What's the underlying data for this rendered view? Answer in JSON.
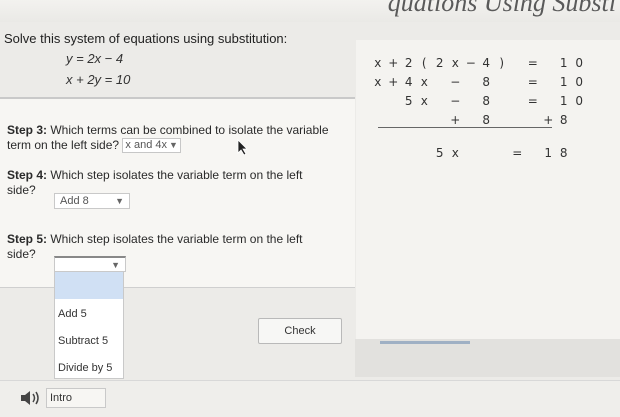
{
  "header": {
    "banner_text": "quations Using Substi"
  },
  "problem": {
    "instruction": "Solve this system of equations using substitution:",
    "equation1": "y = 2x − 4",
    "equation2": "x + 2y = 10"
  },
  "work": {
    "rows": [
      [
        "x",
        "+",
        "2",
        "(",
        "2",
        "x",
        "−",
        "4",
        ")",
        "",
        "=",
        "",
        "1",
        "0"
      ],
      [
        "x",
        "+",
        "4",
        "x",
        "",
        "−",
        "",
        "8",
        "",
        "",
        "=",
        "",
        "1",
        "0"
      ],
      [
        "",
        "",
        "5",
        "x",
        "",
        "−",
        "",
        "8",
        "",
        "",
        "=",
        "",
        "1",
        "0"
      ],
      [
        "",
        "",
        "",
        "",
        "",
        "+",
        "",
        "8",
        "",
        "",
        "",
        "+",
        "8",
        ""
      ],
      [
        "",
        "",
        "",
        "",
        "",
        "",
        "",
        "",
        "",
        "",
        "",
        "",
        "",
        ""
      ],
      [
        "",
        "",
        "",
        "",
        "5",
        "x",
        "",
        "",
        "",
        "=",
        "",
        "1",
        "8",
        ""
      ]
    ]
  },
  "step3": {
    "label": "Step 3:",
    "text": "Which terms can be combined to isolate the variable term on the left side?",
    "selected": "x and 4x"
  },
  "step4": {
    "label": "Step 4:",
    "text": "Which step isolates the variable term on the left side?",
    "selected": "Add 8"
  },
  "step5": {
    "label": "Step 5:",
    "text": "Which step isolates the variable term on the left side?",
    "selected": "",
    "options": [
      "Add 5",
      "Subtract 5",
      "Divide by 5"
    ]
  },
  "buttons": {
    "check": "Check",
    "intro": "Intro"
  },
  "colors": {
    "menu_highlight": "#d0e0f4",
    "accent_bar": "#9fb0c4"
  },
  "icons": {
    "audio": "speaker-icon",
    "cursor": "mouse-pointer-icon"
  }
}
